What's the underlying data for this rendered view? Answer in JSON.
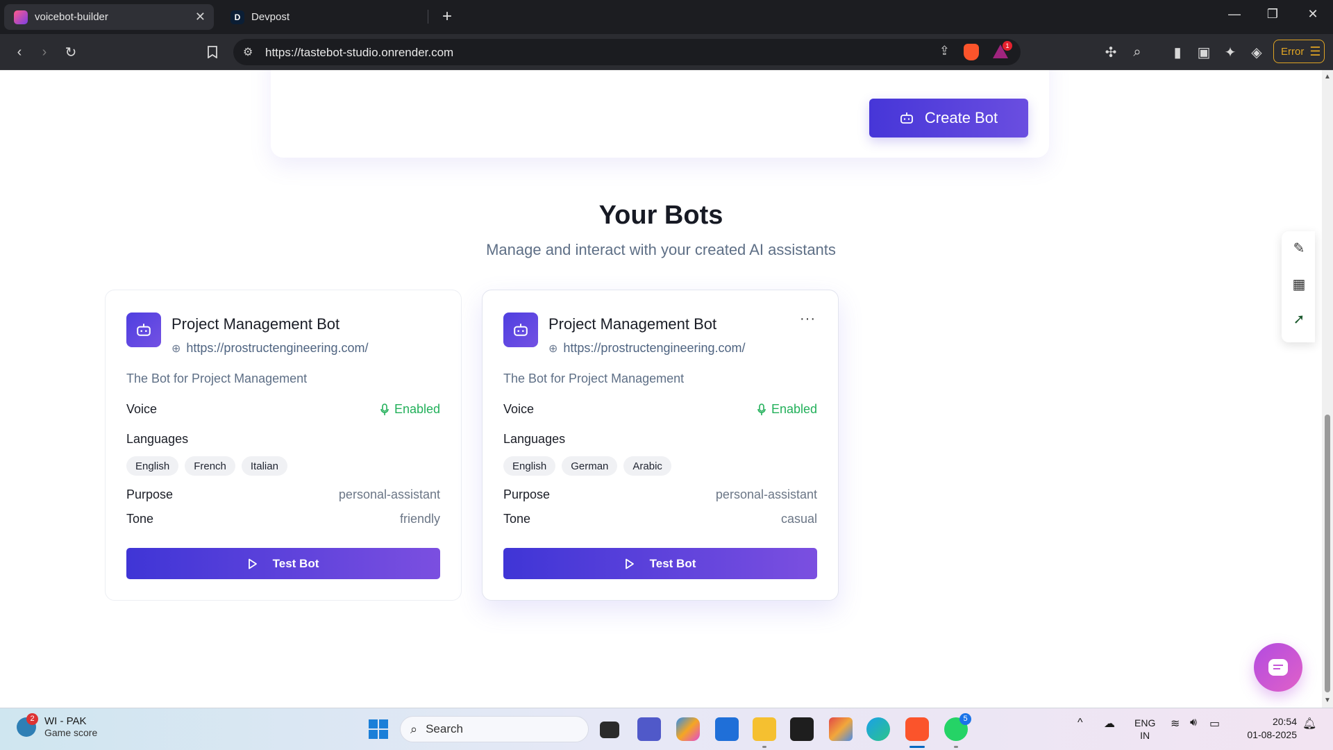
{
  "browser": {
    "tabs": [
      {
        "title": "voicebot-builder",
        "active": true
      },
      {
        "title": "Devpost",
        "active": false
      }
    ],
    "devpost_favicon_letter": "D",
    "address": "https://tastebot-studio.onrender.com",
    "shield_badge": "1",
    "error_label": "Error"
  },
  "page": {
    "create_button": "Create Bot",
    "section_title": "Your Bots",
    "section_subtitle": "Manage and interact with your created AI assistants",
    "labels": {
      "voice": "Voice",
      "languages": "Languages",
      "purpose": "Purpose",
      "tone": "Tone",
      "test_button": "Test Bot"
    },
    "bots": [
      {
        "name": "Project Management Bot",
        "url": "https://prostructengineering.com/",
        "description": "The Bot for Project Management",
        "voice": "Enabled",
        "languages": [
          "English",
          "French",
          "Italian"
        ],
        "purpose": "personal-assistant",
        "tone": "friendly"
      },
      {
        "name": "Project Management Bot",
        "url": "https://prostructengineering.com/",
        "description": "The Bot for Project Management",
        "voice": "Enabled",
        "languages": [
          "English",
          "German",
          "Arabic"
        ],
        "purpose": "personal-assistant",
        "tone": "casual",
        "more": "···"
      }
    ]
  },
  "taskbar": {
    "weather_badge": "2",
    "weather_title": "WI - PAK",
    "weather_subtitle": "Game score",
    "search_label": "Search",
    "whatsapp_badge": "5",
    "lang_line1": "ENG",
    "lang_line2": "IN",
    "time": "20:54",
    "date": "01-08-2025"
  },
  "colors": {
    "accent": "#4636d8",
    "accent_end": "#7b4fe0",
    "enabled_green": "#22b05a",
    "muted_text": "#5e6f86",
    "chat_fab": "#c555d8"
  }
}
